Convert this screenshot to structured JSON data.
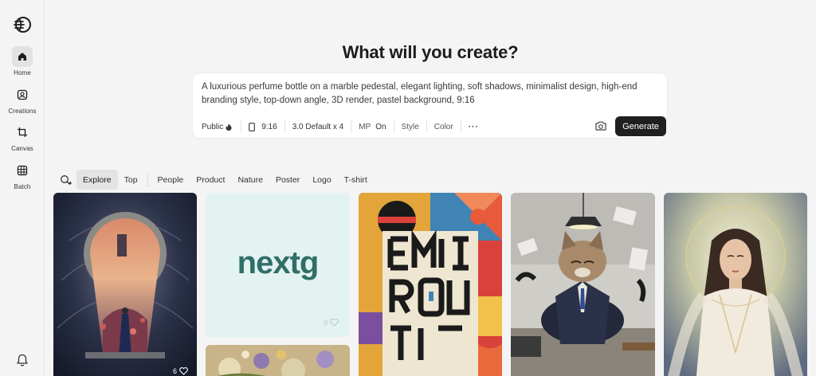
{
  "sidebar": {
    "items": [
      {
        "label": "Home",
        "icon": "home-icon",
        "active": true
      },
      {
        "label": "Creations",
        "icon": "image-icon",
        "active": false
      },
      {
        "label": "Canvas",
        "icon": "crop-icon",
        "active": false
      },
      {
        "label": "Batch",
        "icon": "grid-icon",
        "active": false
      }
    ]
  },
  "header": {
    "title": "What will you create?"
  },
  "prompt": {
    "text": "A luxurious perfume bottle on a marble pedestal, elegant lighting, soft shadows, minimalist design, high-end branding style, top-down angle, 3D render, pastel background, 9:16",
    "tools": {
      "visibility": "Public",
      "ratio": "9:16",
      "model": "3.0 Default x 4",
      "mp_label": "MP",
      "mp_value": "On",
      "style": "Style",
      "color": "Color",
      "more": "···"
    },
    "generate_label": "Generate"
  },
  "filters": {
    "tabs": [
      "Explore",
      "Top",
      "People",
      "Product",
      "Nature",
      "Poster",
      "Logo",
      "T-shirt"
    ],
    "active": "Explore"
  },
  "gallery": {
    "cards": [
      {
        "name": "keyhole-artwork",
        "likes": "6"
      },
      {
        "name": "nextg-logo",
        "text": "nextg",
        "likes": "9"
      },
      {
        "name": "flowers-artwork"
      },
      {
        "name": "typography-poster"
      },
      {
        "name": "kitten-meditating"
      },
      {
        "name": "goddess-portrait"
      }
    ]
  },
  "colors": {
    "accent": "#1f1f21",
    "background": "#f4f4f4",
    "logo_teal": "#2f6f68"
  }
}
